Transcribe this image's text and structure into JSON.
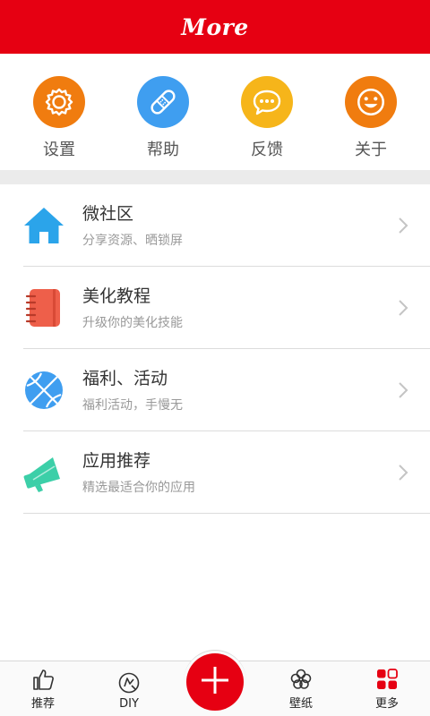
{
  "header": {
    "title": "More"
  },
  "colors": {
    "brand": "#e60012",
    "settings": "#f07c0f",
    "help": "#3f9ef0",
    "feedback": "#f6b51a",
    "about": "#f07c0f",
    "community": "#2ba4ea",
    "tutorial": "#ee5f4a",
    "welfare": "#3f9ef0",
    "recommend": "#3ccfa8"
  },
  "quick_actions": [
    {
      "label": "设置",
      "icon": "gear-icon"
    },
    {
      "label": "帮助",
      "icon": "bandage-icon"
    },
    {
      "label": "反馈",
      "icon": "chat-bubble-icon"
    },
    {
      "label": "关于",
      "icon": "smiley-icon"
    }
  ],
  "menu": [
    {
      "title": "微社区",
      "subtitle": "分享资源、晒锁屏",
      "icon": "house-icon"
    },
    {
      "title": "美化教程",
      "subtitle": "升级你的美化技能",
      "icon": "notebook-icon"
    },
    {
      "title": "福利、活动",
      "subtitle": "福利活动，手慢无",
      "icon": "basketball-icon"
    },
    {
      "title": "应用推荐",
      "subtitle": "精选最适合你的应用",
      "icon": "megaphone-icon"
    }
  ],
  "tabs": [
    {
      "label": "推荐",
      "icon": "thumbs-up-icon"
    },
    {
      "label": "DIY",
      "icon": "diy-icon"
    },
    {
      "label": "壁纸",
      "icon": "flower-icon"
    },
    {
      "label": "更多",
      "icon": "grid-icon",
      "active": true
    }
  ],
  "fab": {
    "icon": "plus-icon"
  }
}
